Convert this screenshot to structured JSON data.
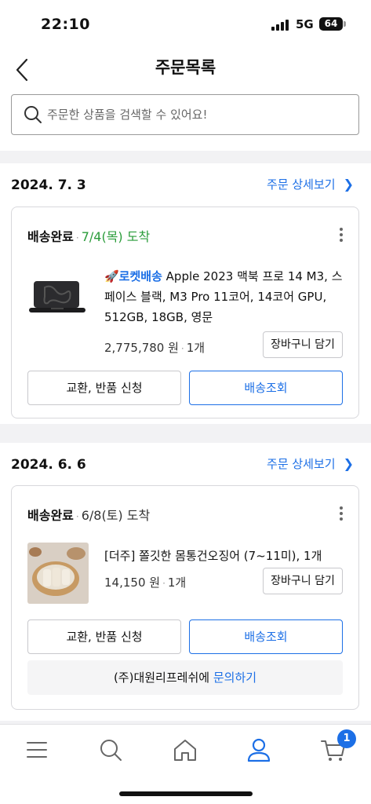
{
  "status_bar": {
    "time": "22:10",
    "network": "5G",
    "battery": "64"
  },
  "header": {
    "title": "주문목록",
    "back_icon": "chevron-left-icon"
  },
  "search": {
    "placeholder": "주문한 상품을 검색할 수 있어요!",
    "value": ""
  },
  "orders": [
    {
      "date": "2024. 7. 3",
      "detail_link": "주문 상세보기",
      "status": "배송완료",
      "arrival": "7/4(목) 도착",
      "rocket_label": "🚀로켓배송",
      "product_name": "Apple 2023 맥북 프로 14 M3, 스페이스 블랙, M3 Pro 11코어, 14코어 GPU, 512GB, 18GB, 영문",
      "price": "2,775,780 원",
      "quantity": "1개",
      "cart_button": "장바구니 담기",
      "exchange_button": "교환, 반품 신청",
      "track_button": "배송조회"
    },
    {
      "date": "2024. 6. 6",
      "detail_link": "주문 상세보기",
      "status": "배송완료",
      "arrival": "6/8(토) 도착",
      "product_name": "[더주] 쫄깃한 몸통건오징어 (7~11미), 1개",
      "price": "14,150 원",
      "quantity": "1개",
      "cart_button": "장바구니 담기",
      "exchange_button": "교환, 반품 신청",
      "track_button": "배송조회",
      "seller": "(주)대원리프레쉬에",
      "inquiry_link": "문의하기"
    }
  ],
  "tab_bar": {
    "items": [
      "menu-icon",
      "search-icon",
      "home-icon",
      "user-icon",
      "cart-icon"
    ],
    "active": "user-icon",
    "cart_badge": "1"
  },
  "colors": {
    "accent": "#1c6fe6",
    "arrival_green": "#2a9c3a"
  }
}
